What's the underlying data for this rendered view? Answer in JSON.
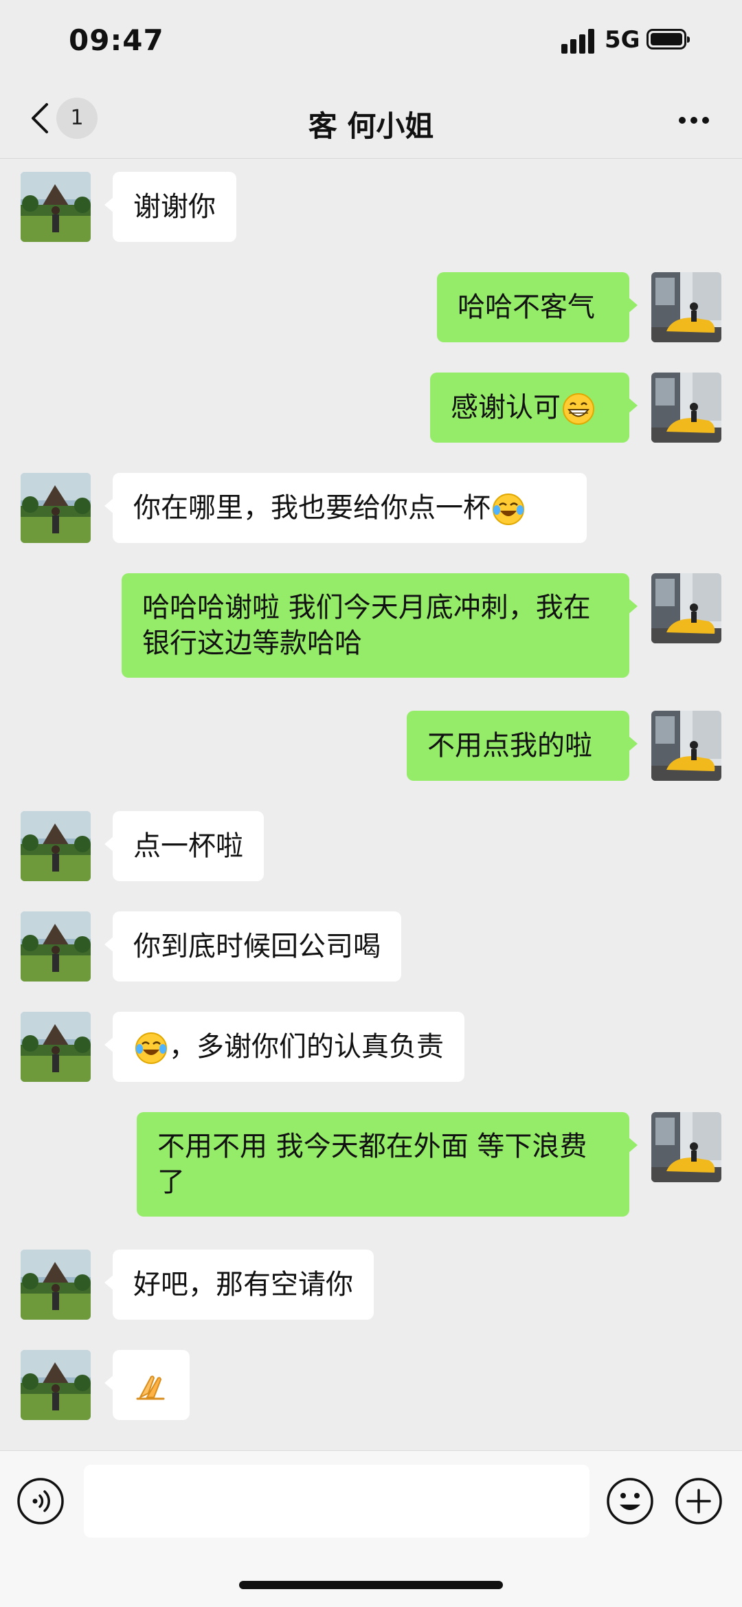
{
  "status_bar": {
    "time": "09:47",
    "network": "5G"
  },
  "header": {
    "back_badge": "1",
    "title": "客 何小姐"
  },
  "messages": [
    {
      "side": "in",
      "segments": [
        {
          "text": "谢谢你"
        }
      ]
    },
    {
      "side": "out",
      "segments": [
        {
          "text": "哈哈不客气"
        }
      ]
    },
    {
      "side": "out",
      "segments": [
        {
          "text": "感谢认可"
        },
        {
          "emoji": "grinning-face-icon"
        }
      ]
    },
    {
      "side": "in",
      "segments": [
        {
          "text": "你在哪里，我也要给你点一杯"
        },
        {
          "emoji": "tears-of-joy-icon"
        }
      ]
    },
    {
      "side": "out",
      "segments": [
        {
          "text": "哈哈哈谢啦  我们今天月底冲刺，我在银行这边等款哈哈"
        }
      ]
    },
    {
      "side": "out",
      "segments": [
        {
          "text": "不用点我的啦"
        }
      ]
    },
    {
      "side": "in",
      "segments": [
        {
          "text": "点一杯啦"
        }
      ]
    },
    {
      "side": "in",
      "segments": [
        {
          "text": "你到底时候回公司喝"
        }
      ]
    },
    {
      "side": "in",
      "segments": [
        {
          "emoji": "tears-of-joy-icon"
        },
        {
          "text": "，多谢你们的认真负责"
        }
      ]
    },
    {
      "side": "out",
      "segments": [
        {
          "text": "不用不用  我今天都在外面  等下浪费了"
        }
      ]
    },
    {
      "side": "in",
      "segments": [
        {
          "text": "好吧，那有空请你"
        }
      ]
    },
    {
      "side": "in",
      "segments": [
        {
          "emoji": "folded-hands-icon"
        }
      ]
    }
  ],
  "input": {
    "value": ""
  },
  "colors": {
    "background": "#ededed",
    "incoming": "#ffffff",
    "outgoing": "#95ec69"
  }
}
